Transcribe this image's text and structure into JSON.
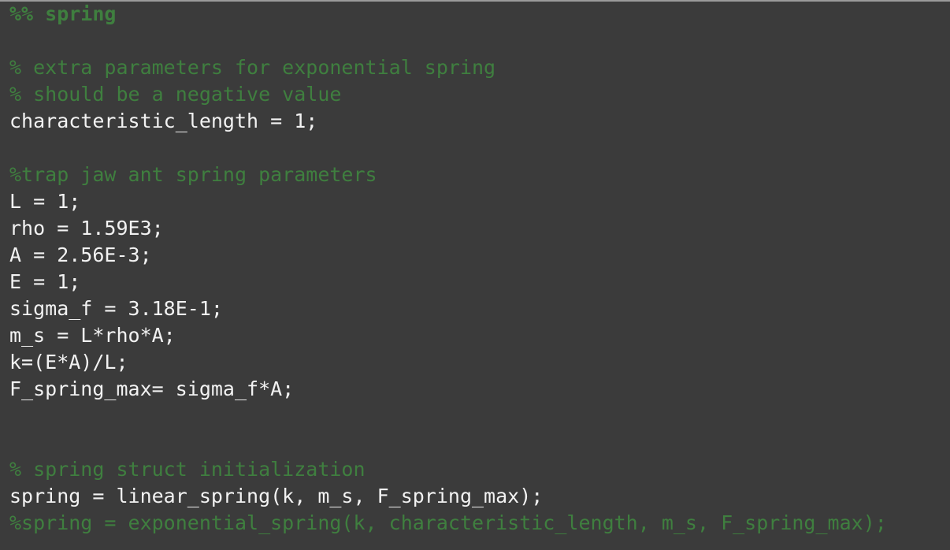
{
  "colors": {
    "background": "#3b3b3b",
    "code_text": "#f2f2f2",
    "comment_text": "#3f7f3f"
  },
  "editor": {
    "lines": [
      {
        "text": "%% spring",
        "kind": "section"
      },
      {
        "text": "",
        "kind": "blank"
      },
      {
        "text": "% extra parameters for exponential spring",
        "kind": "comment"
      },
      {
        "text": "% should be a negative value",
        "kind": "comment"
      },
      {
        "text": "characteristic_length = 1;",
        "kind": "code"
      },
      {
        "text": "",
        "kind": "blank"
      },
      {
        "text": "%trap jaw ant spring parameters",
        "kind": "comment"
      },
      {
        "text": "L = 1;",
        "kind": "code"
      },
      {
        "text": "rho = 1.59E3;",
        "kind": "code"
      },
      {
        "text": "A = 2.56E-3;",
        "kind": "code"
      },
      {
        "text": "E = 1;",
        "kind": "code"
      },
      {
        "text": "sigma_f = 3.18E-1;",
        "kind": "code"
      },
      {
        "text": "m_s = L*rho*A;",
        "kind": "code"
      },
      {
        "text": "k=(E*A)/L;",
        "kind": "code"
      },
      {
        "text": "F_spring_max= sigma_f*A;",
        "kind": "code"
      },
      {
        "text": "",
        "kind": "blank"
      },
      {
        "text": "",
        "kind": "blank"
      },
      {
        "text": "% spring struct initialization",
        "kind": "comment"
      },
      {
        "text": "spring = linear_spring(k, m_s, F_spring_max);",
        "kind": "code"
      },
      {
        "text": "%spring = exponential_spring(k, characteristic_length, m_s, F_spring_max);",
        "kind": "comment"
      }
    ]
  }
}
